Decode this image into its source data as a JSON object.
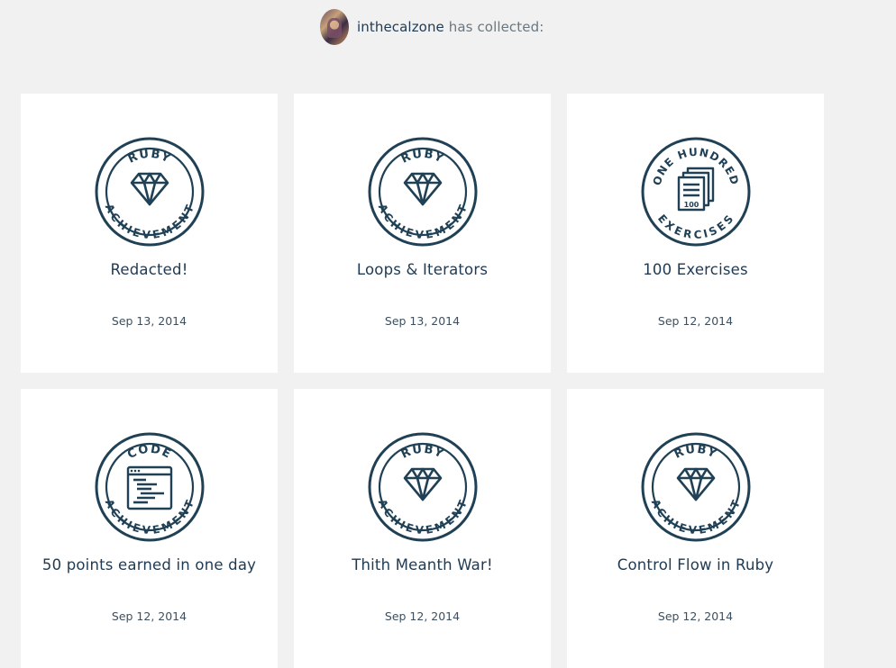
{
  "header": {
    "username": "inthecalzone",
    "suffix": "has collected:"
  },
  "colors": {
    "badge": "#1f4055",
    "background": "#f0f1f0",
    "card": "#ffffff"
  },
  "cards": [
    {
      "title": "Redacted!",
      "date": "Sep 13, 2014",
      "badge_top": "RUBY",
      "badge_bottom": "ACHIEVEMENT",
      "icon": "diamond-icon"
    },
    {
      "title": "Loops & Iterators",
      "date": "Sep 13, 2014",
      "badge_top": "RUBY",
      "badge_bottom": "ACHIEVEMENT",
      "icon": "diamond-icon"
    },
    {
      "title": "100 Exercises",
      "date": "Sep 12, 2014",
      "badge_top": "ONE HUNDRED",
      "badge_bottom": "EXERCISES",
      "icon": "stacked-pages-icon",
      "icon_label": "100"
    },
    {
      "title": "50 points earned in one day",
      "date": "Sep 12, 2014",
      "badge_top": "CODE",
      "badge_bottom": "ACHIEVEMENT",
      "icon": "code-window-icon"
    },
    {
      "title": "Thith Meanth War!",
      "date": "Sep 12, 2014",
      "badge_top": "RUBY",
      "badge_bottom": "ACHIEVEMENT",
      "icon": "diamond-icon"
    },
    {
      "title": "Control Flow in Ruby",
      "date": "Sep 12, 2014",
      "badge_top": "RUBY",
      "badge_bottom": "ACHIEVEMENT",
      "icon": "diamond-icon"
    }
  ]
}
